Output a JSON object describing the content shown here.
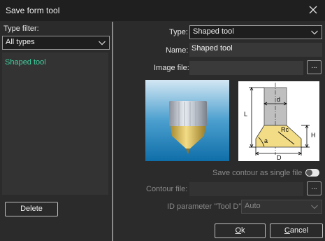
{
  "window": {
    "title": "Save form tool",
    "close_icon": "close-icon"
  },
  "left": {
    "type_filter_label": "Type filter:",
    "type_filter_value": "All types",
    "tool_list": [
      "Shaped tool"
    ],
    "delete_label": "Delete"
  },
  "form": {
    "type_label": "Type:",
    "type_value": "Shaped tool",
    "name_label": "Name:",
    "name_value": "Shaped tool",
    "image_file_label": "Image file:",
    "image_file_value": "",
    "browse_label": "...",
    "diagram_labels": {
      "L": "L",
      "d": "d",
      "Rc": "Rc",
      "a": "a",
      "H": "H",
      "D": "D"
    },
    "save_contour_label": "Save contour as single file",
    "save_contour_on": true,
    "contour_file_label": "Contour file:",
    "contour_file_value": "",
    "id_param_label": "ID parameter \"Tool D\":",
    "id_param_value": "Auto"
  },
  "buttons": {
    "ok_u": "O",
    "ok_rest": "k",
    "cancel_u": "C",
    "cancel_rest": "ancel"
  },
  "colors": {
    "background": "#2b2b2b",
    "titlebar": "#1f1f1f",
    "accent_item": "#3fd2a0",
    "tool_body": "#d9c06a"
  }
}
